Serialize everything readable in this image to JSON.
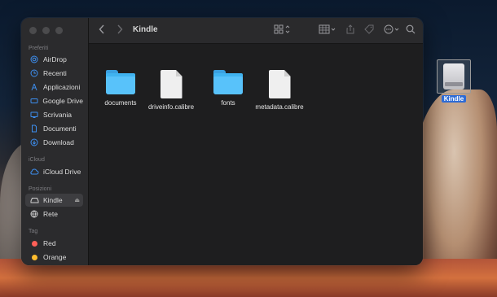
{
  "window": {
    "title": "Kindle"
  },
  "sidebar": {
    "sections": {
      "favorites": "Preferiti",
      "icloud": "iCloud",
      "locations": "Posizioni",
      "tags": "Tag"
    },
    "favorites": [
      {
        "label": "AirDrop",
        "icon": "airdrop-icon"
      },
      {
        "label": "Recenti",
        "icon": "clock-icon"
      },
      {
        "label": "Applicazioni",
        "icon": "apps-icon"
      },
      {
        "label": "Google Drive",
        "icon": "drive-icon"
      },
      {
        "label": "Scrivania",
        "icon": "desktop-icon"
      },
      {
        "label": "Documenti",
        "icon": "document-icon"
      },
      {
        "label": "Download",
        "icon": "download-icon"
      }
    ],
    "icloud": [
      {
        "label": "iCloud Drive",
        "icon": "cloud-icon"
      }
    ],
    "locations": [
      {
        "label": "Kindle",
        "icon": "disk-icon",
        "selected": true
      },
      {
        "label": "Rete",
        "icon": "globe-icon"
      }
    ],
    "tags": [
      {
        "label": "Red",
        "color": "#ff5f57"
      },
      {
        "label": "Orange",
        "color": "#ffbd2e"
      }
    ]
  },
  "files": [
    {
      "name": "documents",
      "kind": "folder"
    },
    {
      "name": "driveinfo.calibre",
      "kind": "file"
    },
    {
      "name": "fonts",
      "kind": "folder"
    },
    {
      "name": "metadata.calibre",
      "kind": "file"
    }
  ],
  "desktop": {
    "drive_label": "Kindle"
  },
  "colors": {
    "accent": "#3d8ff0",
    "folder": "#40b3f0",
    "selection": "#2d6bd6"
  }
}
